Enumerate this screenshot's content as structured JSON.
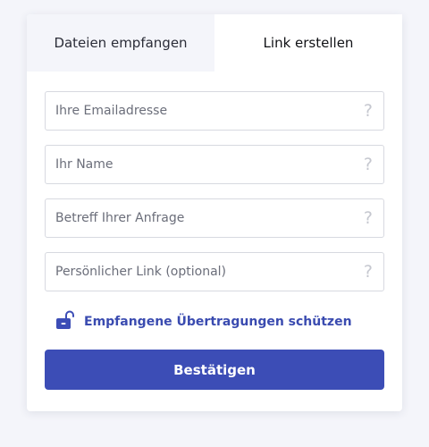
{
  "tabs": {
    "receive": "Dateien empfangen",
    "create_link": "Link erstellen"
  },
  "fields": {
    "email": {
      "placeholder": "Ihre Emailadresse",
      "value": ""
    },
    "name": {
      "placeholder": "Ihr Name",
      "value": ""
    },
    "subject": {
      "placeholder": "Betreff Ihrer Anfrage",
      "value": ""
    },
    "link": {
      "placeholder": "Persönlicher Link (optional)",
      "value": ""
    },
    "help_glyph": "?"
  },
  "protect": {
    "label": "Empfangene Übertragungen schützen",
    "icon": "unlocked-padlock-icon"
  },
  "confirm_label": "Bestätigen",
  "colors": {
    "accent": "#3c4db6",
    "link_text": "#3a4bb0",
    "page_bg": "#f4f5fa",
    "border": "#d7d9e0"
  }
}
